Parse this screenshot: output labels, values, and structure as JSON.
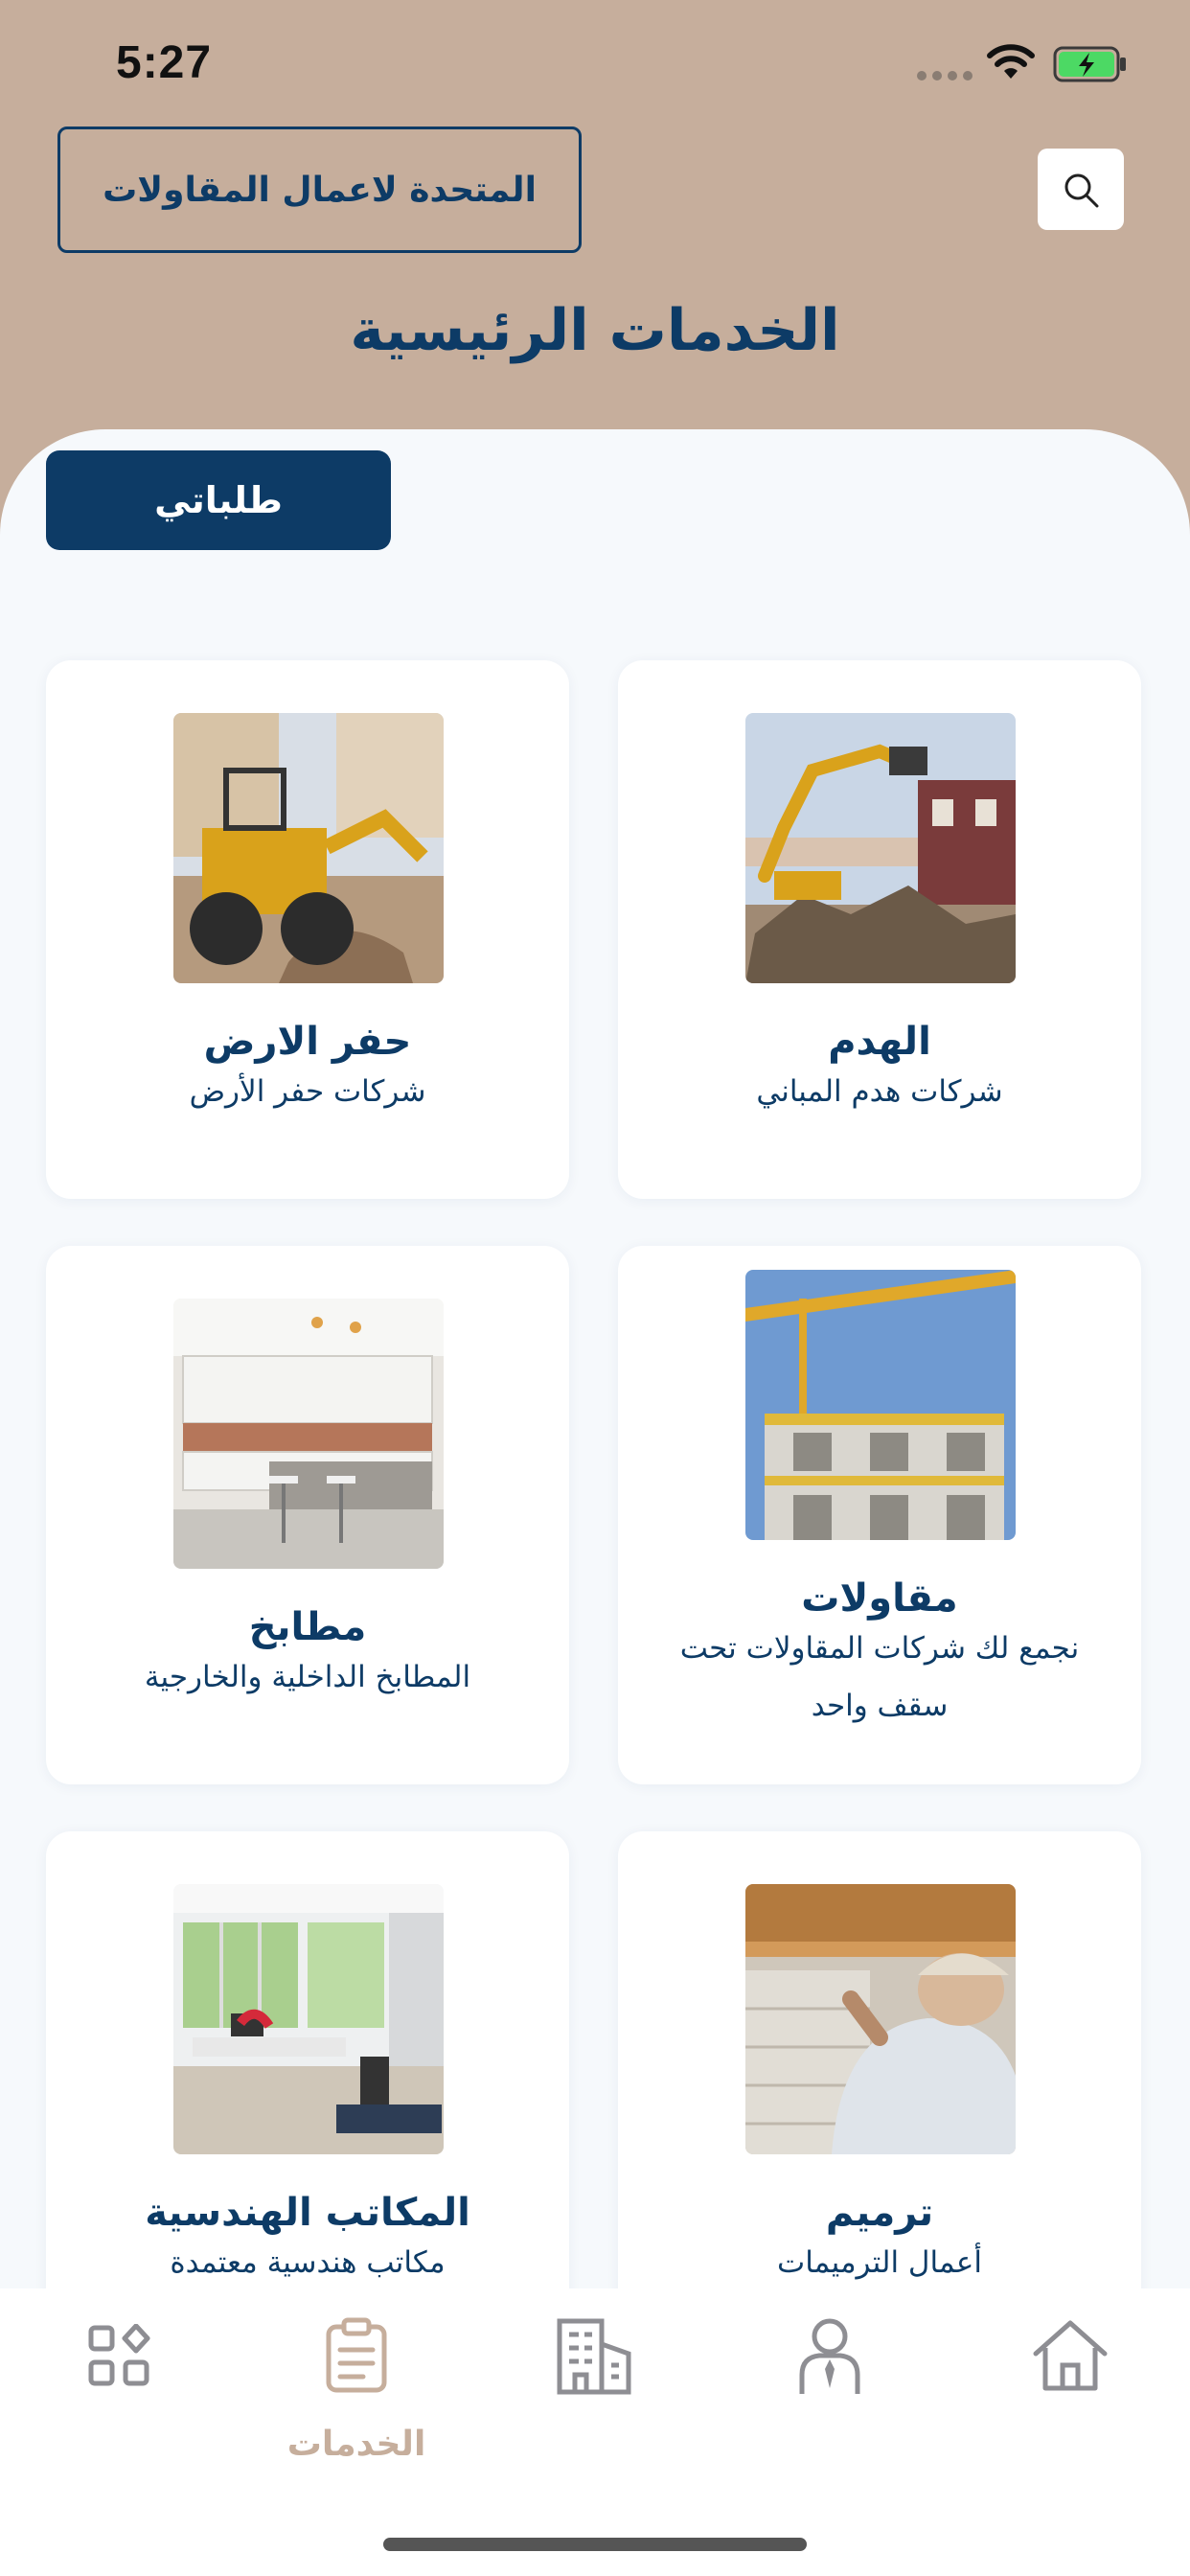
{
  "status_bar": {
    "time": "5:27"
  },
  "header": {
    "company_name": "المتحدة لاعمال المقاولات",
    "title": "الخدمات الرئيسية"
  },
  "requests_button": "طلباتي",
  "services": [
    {
      "title": "الهدم",
      "description": "شركات هدم المباني",
      "icon": "demolition-photo"
    },
    {
      "title": "حفر الارض",
      "description": "شركات حفر الأرض",
      "icon": "excavation-photo"
    },
    {
      "title": "مقاولات",
      "description": "نجمع لك شركات المقاولات تحت سقف واحد",
      "icon": "construction-photo"
    },
    {
      "title": "مطابخ",
      "description": "المطابخ الداخلية والخارجية",
      "icon": "kitchen-photo"
    },
    {
      "title": "ترميم",
      "description": "أعمال الترميمات",
      "icon": "renovation-photo"
    },
    {
      "title": "المكاتب الهندسية",
      "description": "مكاتب هندسية معتمدة",
      "icon": "office-photo"
    }
  ],
  "bottom_nav": {
    "active_label": "الخدمات",
    "items": [
      "home-icon",
      "profile-icon",
      "buildings-icon",
      "services-clipboard-icon",
      "categories-grid-icon"
    ]
  },
  "colors": {
    "primary": "#0d3b66",
    "accent": "#c6ae9c",
    "panel": "#f6f9fc"
  }
}
